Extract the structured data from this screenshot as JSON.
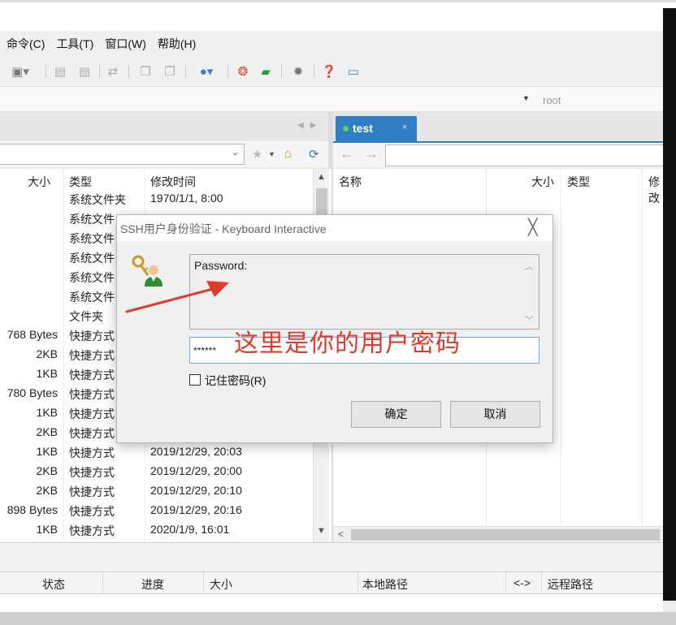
{
  "menu": [
    "命令(C)",
    "工具(T)",
    "窗口(W)",
    "帮助(H)"
  ],
  "address": {
    "session_hint": "root"
  },
  "tabs": [
    {
      "label": "test",
      "close": "×"
    }
  ],
  "left_table": {
    "headers": {
      "size": "大小",
      "type": "类型",
      "modified": "修改时间"
    },
    "rows": [
      {
        "size": "",
        "type": "系统文件夹",
        "modified": "1970/1/1, 8:00"
      },
      {
        "size": "",
        "type": "系统文件",
        "modified": ""
      },
      {
        "size": "",
        "type": "系统文件",
        "modified": ""
      },
      {
        "size": "",
        "type": "系统文件",
        "modified": ""
      },
      {
        "size": "",
        "type": "系统文件",
        "modified": ""
      },
      {
        "size": "",
        "type": "系统文件",
        "modified": ""
      },
      {
        "size": "",
        "type": "文件夹",
        "modified": ""
      },
      {
        "size": "768 Bytes",
        "type": "快捷方式",
        "modified": ""
      },
      {
        "size": "2KB",
        "type": "快捷方式",
        "modified": ""
      },
      {
        "size": "1KB",
        "type": "快捷方式",
        "modified": ""
      },
      {
        "size": "780 Bytes",
        "type": "快捷方式",
        "modified": ""
      },
      {
        "size": "1KB",
        "type": "快捷方式",
        "modified": ""
      },
      {
        "size": "2KB",
        "type": "快捷方式",
        "modified": ""
      },
      {
        "size": "1KB",
        "type": "快捷方式",
        "modified": "2019/12/29, 20:03"
      },
      {
        "size": "2KB",
        "type": "快捷方式",
        "modified": "2019/12/29, 20:00"
      },
      {
        "size": "2KB",
        "type": "快捷方式",
        "modified": "2019/12/29, 20:10"
      },
      {
        "size": "898 Bytes",
        "type": "快捷方式",
        "modified": "2019/12/29, 20:16"
      },
      {
        "size": "1KB",
        "type": "快捷方式",
        "modified": "2020/1/9, 16:01"
      }
    ]
  },
  "right_table": {
    "headers": {
      "name": "名称",
      "size": "大小",
      "type": "类型",
      "modified": "修改"
    }
  },
  "transfer": {
    "headers": {
      "status": "状态",
      "progress": "进度",
      "size": "大小",
      "local_path": "本地路径",
      "direction": "<->",
      "remote_path": "远程路径"
    }
  },
  "dialog": {
    "title": "SSH用户身份验证 - Keyboard Interactive",
    "close": "╳",
    "prompt": "Password:",
    "password_value": "******",
    "remember_label": "记住密码(R)",
    "ok_label": "确定",
    "cancel_label": "取消"
  },
  "annotation": {
    "text": "这里是你的用户密码",
    "color": "#e03a2c"
  },
  "colors": {
    "tab_active": "#2f7fc4",
    "tab_dot": "#5fd05f"
  }
}
